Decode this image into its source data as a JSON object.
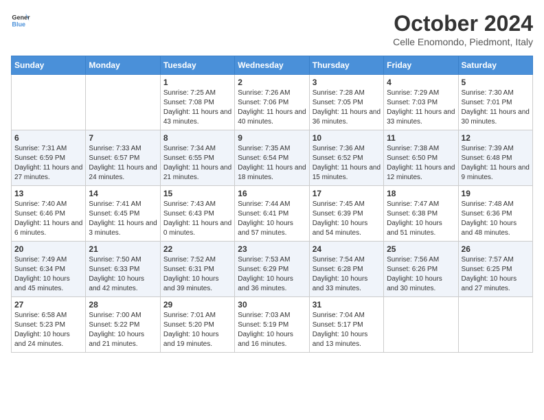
{
  "header": {
    "logo_line1": "General",
    "logo_line2": "Blue",
    "month_title": "October 2024",
    "location": "Celle Enomondo, Piedmont, Italy"
  },
  "columns": [
    "Sunday",
    "Monday",
    "Tuesday",
    "Wednesday",
    "Thursday",
    "Friday",
    "Saturday"
  ],
  "weeks": [
    {
      "days": [
        {
          "num": "",
          "info": ""
        },
        {
          "num": "",
          "info": ""
        },
        {
          "num": "1",
          "info": "Sunrise: 7:25 AM\nSunset: 7:08 PM\nDaylight: 11 hours and 43 minutes."
        },
        {
          "num": "2",
          "info": "Sunrise: 7:26 AM\nSunset: 7:06 PM\nDaylight: 11 hours and 40 minutes."
        },
        {
          "num": "3",
          "info": "Sunrise: 7:28 AM\nSunset: 7:05 PM\nDaylight: 11 hours and 36 minutes."
        },
        {
          "num": "4",
          "info": "Sunrise: 7:29 AM\nSunset: 7:03 PM\nDaylight: 11 hours and 33 minutes."
        },
        {
          "num": "5",
          "info": "Sunrise: 7:30 AM\nSunset: 7:01 PM\nDaylight: 11 hours and 30 minutes."
        }
      ]
    },
    {
      "days": [
        {
          "num": "6",
          "info": "Sunrise: 7:31 AM\nSunset: 6:59 PM\nDaylight: 11 hours and 27 minutes."
        },
        {
          "num": "7",
          "info": "Sunrise: 7:33 AM\nSunset: 6:57 PM\nDaylight: 11 hours and 24 minutes."
        },
        {
          "num": "8",
          "info": "Sunrise: 7:34 AM\nSunset: 6:55 PM\nDaylight: 11 hours and 21 minutes."
        },
        {
          "num": "9",
          "info": "Sunrise: 7:35 AM\nSunset: 6:54 PM\nDaylight: 11 hours and 18 minutes."
        },
        {
          "num": "10",
          "info": "Sunrise: 7:36 AM\nSunset: 6:52 PM\nDaylight: 11 hours and 15 minutes."
        },
        {
          "num": "11",
          "info": "Sunrise: 7:38 AM\nSunset: 6:50 PM\nDaylight: 11 hours and 12 minutes."
        },
        {
          "num": "12",
          "info": "Sunrise: 7:39 AM\nSunset: 6:48 PM\nDaylight: 11 hours and 9 minutes."
        }
      ]
    },
    {
      "days": [
        {
          "num": "13",
          "info": "Sunrise: 7:40 AM\nSunset: 6:46 PM\nDaylight: 11 hours and 6 minutes."
        },
        {
          "num": "14",
          "info": "Sunrise: 7:41 AM\nSunset: 6:45 PM\nDaylight: 11 hours and 3 minutes."
        },
        {
          "num": "15",
          "info": "Sunrise: 7:43 AM\nSunset: 6:43 PM\nDaylight: 11 hours and 0 minutes."
        },
        {
          "num": "16",
          "info": "Sunrise: 7:44 AM\nSunset: 6:41 PM\nDaylight: 10 hours and 57 minutes."
        },
        {
          "num": "17",
          "info": "Sunrise: 7:45 AM\nSunset: 6:39 PM\nDaylight: 10 hours and 54 minutes."
        },
        {
          "num": "18",
          "info": "Sunrise: 7:47 AM\nSunset: 6:38 PM\nDaylight: 10 hours and 51 minutes."
        },
        {
          "num": "19",
          "info": "Sunrise: 7:48 AM\nSunset: 6:36 PM\nDaylight: 10 hours and 48 minutes."
        }
      ]
    },
    {
      "days": [
        {
          "num": "20",
          "info": "Sunrise: 7:49 AM\nSunset: 6:34 PM\nDaylight: 10 hours and 45 minutes."
        },
        {
          "num": "21",
          "info": "Sunrise: 7:50 AM\nSunset: 6:33 PM\nDaylight: 10 hours and 42 minutes."
        },
        {
          "num": "22",
          "info": "Sunrise: 7:52 AM\nSunset: 6:31 PM\nDaylight: 10 hours and 39 minutes."
        },
        {
          "num": "23",
          "info": "Sunrise: 7:53 AM\nSunset: 6:29 PM\nDaylight: 10 hours and 36 minutes."
        },
        {
          "num": "24",
          "info": "Sunrise: 7:54 AM\nSunset: 6:28 PM\nDaylight: 10 hours and 33 minutes."
        },
        {
          "num": "25",
          "info": "Sunrise: 7:56 AM\nSunset: 6:26 PM\nDaylight: 10 hours and 30 minutes."
        },
        {
          "num": "26",
          "info": "Sunrise: 7:57 AM\nSunset: 6:25 PM\nDaylight: 10 hours and 27 minutes."
        }
      ]
    },
    {
      "days": [
        {
          "num": "27",
          "info": "Sunrise: 6:58 AM\nSunset: 5:23 PM\nDaylight: 10 hours and 24 minutes."
        },
        {
          "num": "28",
          "info": "Sunrise: 7:00 AM\nSunset: 5:22 PM\nDaylight: 10 hours and 21 minutes."
        },
        {
          "num": "29",
          "info": "Sunrise: 7:01 AM\nSunset: 5:20 PM\nDaylight: 10 hours and 19 minutes."
        },
        {
          "num": "30",
          "info": "Sunrise: 7:03 AM\nSunset: 5:19 PM\nDaylight: 10 hours and 16 minutes."
        },
        {
          "num": "31",
          "info": "Sunrise: 7:04 AM\nSunset: 5:17 PM\nDaylight: 10 hours and 13 minutes."
        },
        {
          "num": "",
          "info": ""
        },
        {
          "num": "",
          "info": ""
        }
      ]
    }
  ]
}
